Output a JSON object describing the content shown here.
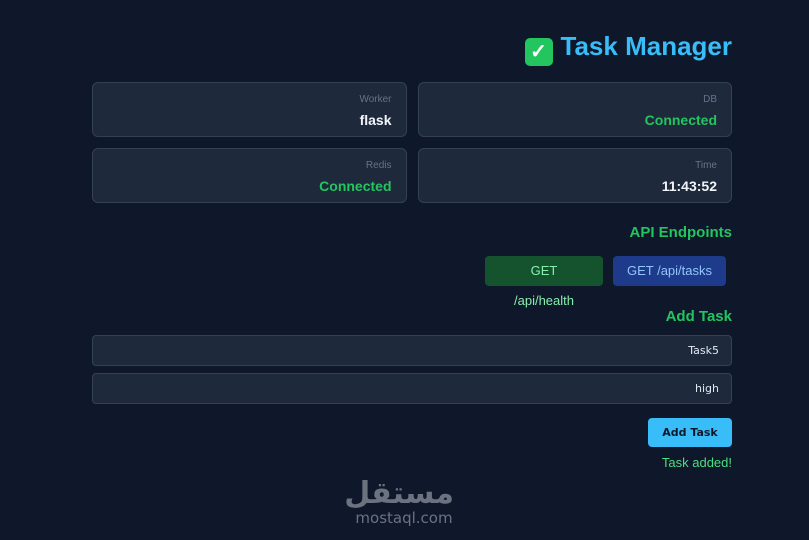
{
  "header": {
    "title": "Task Manager",
    "icon": "check-mark-icon"
  },
  "status_cards": [
    {
      "label": "DB",
      "value": "Connected",
      "color": "#22c55e"
    },
    {
      "label": "Worker",
      "value": "flask",
      "color": "#f1f5f9"
    },
    {
      "label": "Time",
      "value": "11:43:52",
      "color": "#f1f5f9"
    },
    {
      "label": "Redis",
      "value": "Connected",
      "color": "#22c55e"
    }
  ],
  "api": {
    "heading": "API Endpoints",
    "health": "GET /api/health",
    "tasks": "GET /api/tasks"
  },
  "add_task": {
    "heading": "Add Task",
    "name_value": "Task5",
    "priority_value": "high",
    "button": "Add Task",
    "message": "Task added!"
  },
  "watermark": {
    "arabic": "مستقل",
    "latin": "mostaql.com"
  }
}
